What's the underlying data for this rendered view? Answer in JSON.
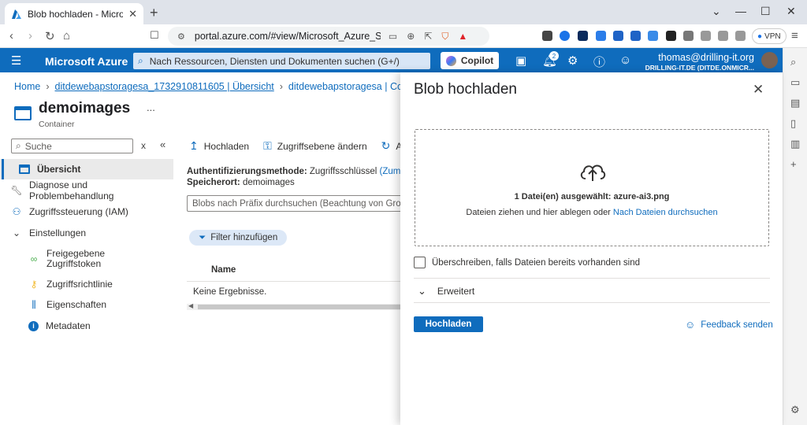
{
  "browser": {
    "tab_title": "Blob hochladen - Microsoft Azure",
    "url": "portal.azure.com/#view/Microsoft_Azure_Storage...",
    "vpn_label": "VPN"
  },
  "azure_header": {
    "brand": "Microsoft Azure",
    "search_placeholder": "Nach Ressourcen, Diensten und Dokumenten suchen (G+/)",
    "copilot_label": "Copilot",
    "notification_count": "2",
    "user_email": "thomas@drilling-it.org",
    "user_tenant": "DRILLING-IT.DE (DITDE.ONMICR..."
  },
  "breadcrumb": {
    "home": "Home",
    "overview": "ditdewebapstoragesa_1732910811605 | Übersicht",
    "container": "ditdewebapstoragesa | Container"
  },
  "resource": {
    "title": "demoimages",
    "more": "...",
    "subtitle": "Container"
  },
  "left_menu": {
    "search_placeholder": "Suche",
    "items": [
      {
        "label": "Übersicht"
      },
      {
        "label": "Diagnose und Problembehandlung"
      },
      {
        "label": "Zugriffssteuerung (IAM)"
      },
      {
        "label": "Einstellungen"
      },
      {
        "label": "Freigegebene Zugriffstoken"
      },
      {
        "label": "Zugriffsrichtlinie"
      },
      {
        "label": "Eigenschaften"
      },
      {
        "label": "Metadaten"
      }
    ]
  },
  "commands": {
    "upload": "Hochladen",
    "access_level": "Zugriffsebene ändern",
    "refresh": "Aktua"
  },
  "overview": {
    "auth_label": "Authentifizierungsmethode:",
    "auth_value": "Zugriffsschlüssel",
    "auth_link": "(Zum Mic",
    "location_label": "Speicherort:",
    "location_value": "demoimages",
    "blob_search_placeholder": "Blobs nach Präfix durchsuchen (Beachtung von Groß-/Kl",
    "filter_label": "Filter hinzufügen",
    "column_name": "Name",
    "empty_text": "Keine Ergebnisse."
  },
  "blade": {
    "title": "Blob hochladen",
    "selected_files": "1 Datei(en) ausgewählt: azure-ai3.png",
    "drop_text": "Dateien ziehen und hier ablegen  oder",
    "browse_link": "Nach Dateien durchsuchen",
    "overwrite_label": "Überschreiben, falls Dateien bereits vorhanden sind",
    "advanced_label": "Erweitert",
    "upload_button": "Hochladen",
    "feedback_label": "Feedback senden"
  },
  "colors": {
    "azure_blue": "#0f6cbd",
    "chrome_bg": "#dfe3ea"
  }
}
